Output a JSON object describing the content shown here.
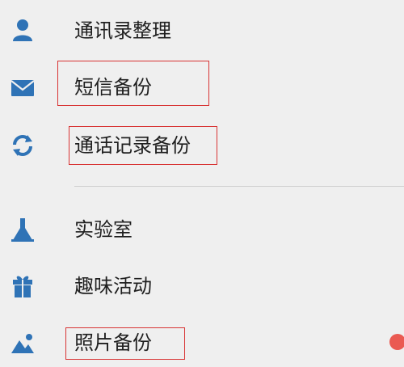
{
  "menu": {
    "items": [
      {
        "label": "通讯录整理",
        "icon": "user-icon"
      },
      {
        "label": "短信备份",
        "icon": "mail-icon"
      },
      {
        "label": "通话记录备份",
        "icon": "sync-icon"
      },
      {
        "label": "实验室",
        "icon": "flask-icon"
      },
      {
        "label": "趣味活动",
        "icon": "gift-icon"
      },
      {
        "label": "照片备份",
        "icon": "photo-icon"
      }
    ]
  },
  "theme": {
    "icon_color": "#2f73b6",
    "highlight_color": "#d83434",
    "notification_dot_color": "#ea5a52",
    "background": "#efefef"
  }
}
